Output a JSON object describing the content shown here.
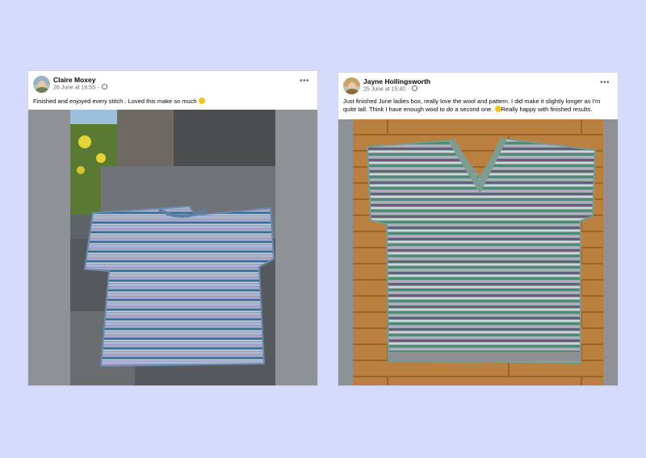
{
  "posts": [
    {
      "author": "Claire Moxey",
      "timestamp": "26 June at 16:55",
      "message": "Finished and enjoyed every stitch . Loved this make so much",
      "more_icon": "more-options-icon",
      "privacy_icon": "globe-icon",
      "photo_subject": "blue striped knitted top on garden chair"
    },
    {
      "author": "Jayne Hollingsworth",
      "timestamp": "25 June at 15:40",
      "message": "Just finished June ladies box, really love the wool and pattern. I did make it slightly longer as I'm quite tall. Think I have enough wool to do a second one.",
      "message_end": "Really happy with finished results.",
      "more_icon": "more-options-icon",
      "privacy_icon": "globe-icon",
      "photo_subject": "green and lilac knitted v-neck top on wooden floor"
    }
  ],
  "colors": {
    "background": "#d7dbfb",
    "card": "#ffffff",
    "text_primary": "#050505",
    "text_secondary": "#65676b"
  }
}
